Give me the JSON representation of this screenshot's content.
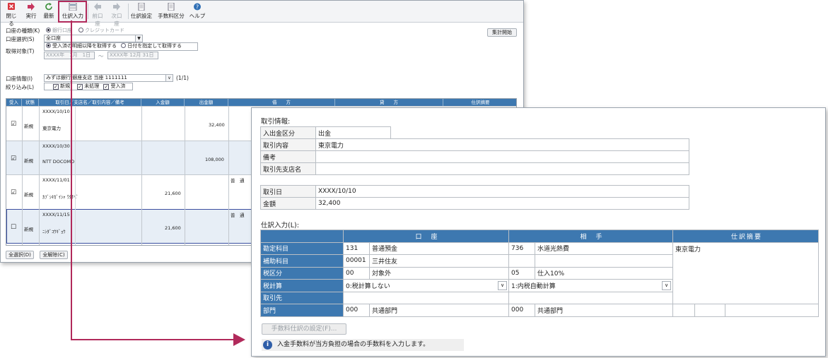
{
  "toolbar": {
    "close": "閉じる",
    "execute": "実行",
    "refresh": "最新",
    "journal_input": "仕訳入力",
    "prev": "前口座",
    "next": "次口座",
    "journal_settings": "仕訳設定",
    "fee_category": "手数料区分",
    "help": "ヘルプ"
  },
  "form": {
    "account_type_label": "口座の種類(K)",
    "account_type_options": [
      "銀行口座",
      "クレジットカード"
    ],
    "account_select_label": "口座選択(S)",
    "account_select_value": "全口座",
    "period_label": "取得対象(T)",
    "period_option_1": "受入済の明細以降を取得する",
    "period_option_2": "日付を指定して取得する",
    "date_from": "XXXX年　1月　1日",
    "date_sep": "～",
    "date_to": "XXXX年 12月 31日",
    "start_button": "集計開始",
    "account_info_label": "口座情報(I)",
    "account_info_value": "みずほ銀行 銀座支店 当座 1111111",
    "account_info_count": "(1/1)",
    "filter_label": "絞り込み(L)",
    "filter_new": "新規",
    "filter_unprocessed": "未処理",
    "filter_received": "受入済",
    "select_all": "全選択(D)",
    "deselect_all": "全解除(C)"
  },
  "grid": {
    "headers": [
      "受入",
      "状態",
      "取引日／支店名／取引内容／備考",
      "入金額",
      "出金額",
      "借　　方",
      "貸　　方",
      "仕訳摘要"
    ],
    "rows": [
      {
        "date": "XXXX/10/10",
        "name": "東京電力",
        "status": "新規",
        "deposit": "",
        "withdrawal": "32,400",
        "checked": "☑"
      },
      {
        "date": "XXXX/10/30",
        "name": "NTT DOCOMO",
        "status": "新規",
        "deposit": "",
        "withdrawal": "108,000",
        "checked": "☑"
      },
      {
        "date": "XXXX/11/01",
        "name": "ｶﾌﾞｼｷｶﾞｲｼｬ ﾜﾀﾅﾍﾞ",
        "status": "新規",
        "deposit": "21,600",
        "withdrawal": "",
        "checked": "☑"
      },
      {
        "date": "XXXX/11/15",
        "name": "ﾆｼﾀﾞｺｳｷﾞｮｳ",
        "status": "新規",
        "deposit": "21,600",
        "withdrawal": "",
        "checked": "☐"
      }
    ],
    "row_fragment": "普　通"
  },
  "detail": {
    "info_title": "取引情報:",
    "io_label": "入出金区分",
    "io_value": "出金",
    "content_label": "取引内容",
    "content_value": "東京電力",
    "memo_label": "備考",
    "memo_value": "",
    "branch_label": "取引先支店名",
    "branch_value": "",
    "date_label": "取引日",
    "date_value": "XXXX/10/10",
    "amount_label": "金額",
    "amount_value": "32,400",
    "journal_title": "仕訳入力(L):",
    "col_account": "口　座",
    "col_counter": "相　手",
    "col_summary": "仕訳摘要",
    "summary_value": "東京電力",
    "rows": [
      {
        "label": "勘定科目",
        "a_code": "131",
        "a_name": "普通預金",
        "c_code": "736",
        "c_name": "水道光熱費"
      },
      {
        "label": "補助科目",
        "a_code": "00001",
        "a_name": "三井住友",
        "c_code": "",
        "c_name": ""
      },
      {
        "label": "税区分",
        "a_code": "00",
        "a_name": "対象外",
        "c_code": "05",
        "c_name": "仕入10%"
      },
      {
        "label": "税計算",
        "a_code": "0:税計算しない",
        "a_name": "",
        "c_code": "1:内税自動計算",
        "c_name": ""
      },
      {
        "label": "取引先",
        "a_code": "",
        "a_name": "",
        "c_code": "",
        "c_name": ""
      },
      {
        "label": "部門",
        "a_code": "000",
        "a_name": "共通部門",
        "c_code": "000",
        "c_name": "共通部門"
      }
    ],
    "fee_button": "手数料仕訳の設定(F)...",
    "info_message": "入金手数料が当方負担の場合の手数料を入力します。"
  },
  "colors": {
    "header_blue": "#3d78b0",
    "highlight": "#b12a5b"
  }
}
